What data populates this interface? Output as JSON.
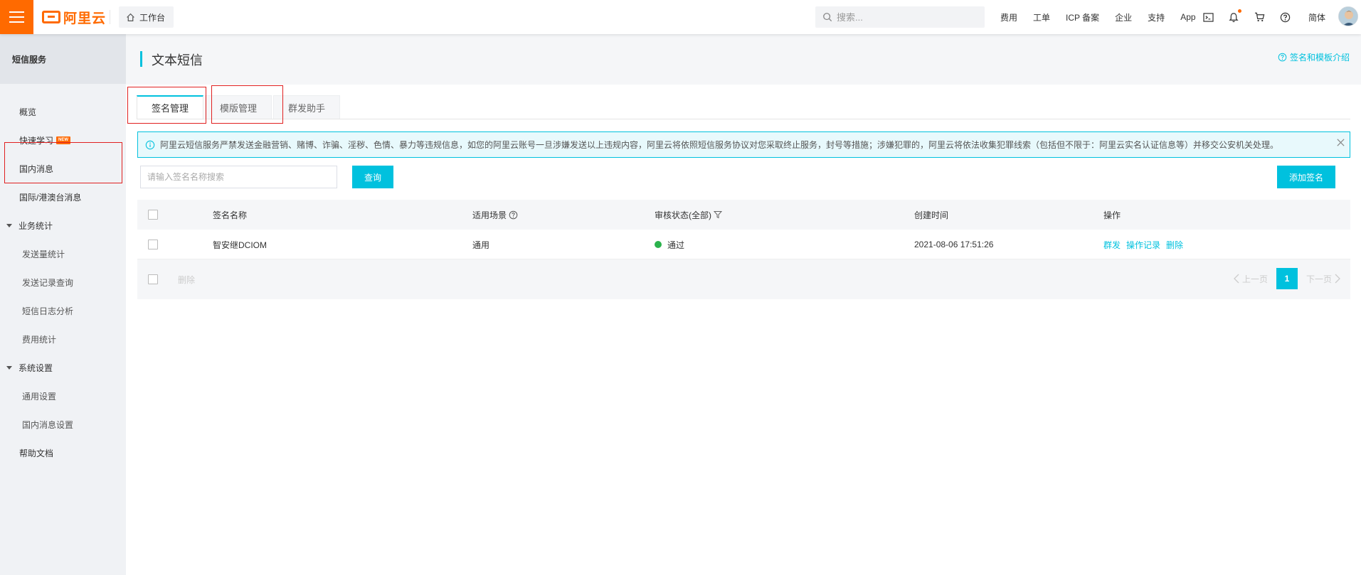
{
  "topbar": {
    "logo_text": "阿里云",
    "workbench_label": "工作台",
    "search_placeholder": "搜索...",
    "nav": [
      "费用",
      "工单",
      "ICP 备案",
      "企业",
      "支持",
      "App"
    ],
    "lang": "简体",
    "icons": [
      "terminal-icon",
      "bell-icon",
      "cart-icon",
      "help-icon"
    ]
  },
  "sidebar": {
    "title": "短信服务",
    "items": [
      {
        "label": "概览"
      },
      {
        "label": "快速学习",
        "badge": "NEW"
      },
      {
        "label": "国内消息"
      },
      {
        "label": "国际/港澳台消息"
      }
    ],
    "groups": [
      {
        "label": "业务统计",
        "children": [
          "发送量统计",
          "发送记录查询",
          "短信日志分析",
          "费用统计"
        ]
      },
      {
        "label": "系统设置",
        "children": [
          "通用设置",
          "国内消息设置"
        ]
      }
    ],
    "help": "帮助文档"
  },
  "main": {
    "title": "文本短信",
    "intro_link": "签名和模板介绍",
    "tabs": [
      "签名管理",
      "模版管理",
      "群发助手"
    ],
    "notice": "阿里云短信服务严禁发送金融营销、赌博、诈骗、淫秽、色情、暴力等违规信息，如您的阿里云账号一旦涉嫌发送以上违规内容，阿里云将依照短信服务协议对您采取终止服务，封号等措施；涉嫌犯罪的，阿里云将依法收集犯罪线索（包括但不限于：阿里云实名认证信息等）并移交公安机关处理。",
    "search_placeholder": "请输入签名名称搜索",
    "query_button": "查询",
    "add_button": "添加签名",
    "table": {
      "headers": [
        "签名名称",
        "适用场景",
        "审核状态(全部)",
        "创建时间",
        "操作"
      ],
      "rows": [
        {
          "name": "智安继DCIOM",
          "scene": "通用",
          "status": "通过",
          "created": "2021-08-06 17:51:26",
          "ops": [
            "群发",
            "操作记录",
            "删除"
          ]
        }
      ],
      "footer_delete": "删除"
    },
    "pagination": {
      "prev": "上一页",
      "current": "1",
      "next": "下一页"
    }
  },
  "colors": {
    "brand": "#ff6a00",
    "accent": "#00c1de",
    "success": "#2bb24c",
    "annotation": "#e02020"
  }
}
